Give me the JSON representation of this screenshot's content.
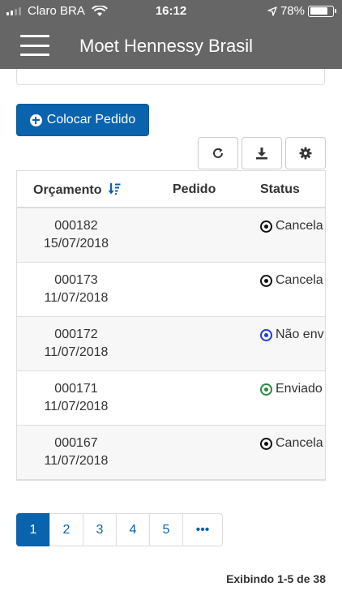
{
  "status_bar": {
    "carrier": "Claro BRA",
    "time": "16:12",
    "battery": "78%",
    "battery_level": 0.78,
    "icons": [
      "signal-icon",
      "wifi-icon",
      "location-arrow-icon",
      "battery-icon"
    ]
  },
  "header": {
    "title": "Moet Hennessy Brasil",
    "menu_icon": "hamburger-menu-icon"
  },
  "actions": {
    "new_order_label": "Colocar Pedido",
    "new_order_icon": "plus-circle-icon",
    "toolbar_icons": [
      "refresh-icon",
      "download-icon",
      "gear-icon"
    ]
  },
  "table": {
    "columns": [
      "Orçamento",
      "Pedido",
      "Status"
    ],
    "sort_icon": "sort-descending-icon",
    "rows": [
      {
        "orcamento": "000182",
        "date": "15/07/2018",
        "pedido": "",
        "status": "Cancela",
        "status_color": "#111111"
      },
      {
        "orcamento": "000173",
        "date": "11/07/2018",
        "pedido": "",
        "status": "Cancela",
        "status_color": "#111111"
      },
      {
        "orcamento": "000172",
        "date": "11/07/2018",
        "pedido": "",
        "status": "Não env",
        "status_color": "#1e3fd6"
      },
      {
        "orcamento": "000171",
        "date": "11/07/2018",
        "pedido": "",
        "status": "Enviado",
        "status_color": "#2b8a3e"
      },
      {
        "orcamento": "000167",
        "date": "11/07/2018",
        "pedido": "",
        "status": "Cancela",
        "status_color": "#111111"
      }
    ]
  },
  "pagination": {
    "pages": [
      "1",
      "2",
      "3",
      "4",
      "5",
      "•••"
    ],
    "active": "1"
  },
  "summary": "Exibindo 1-5 de 38",
  "colors": {
    "header_bg": "#666666",
    "primary": "#0a63ad"
  }
}
